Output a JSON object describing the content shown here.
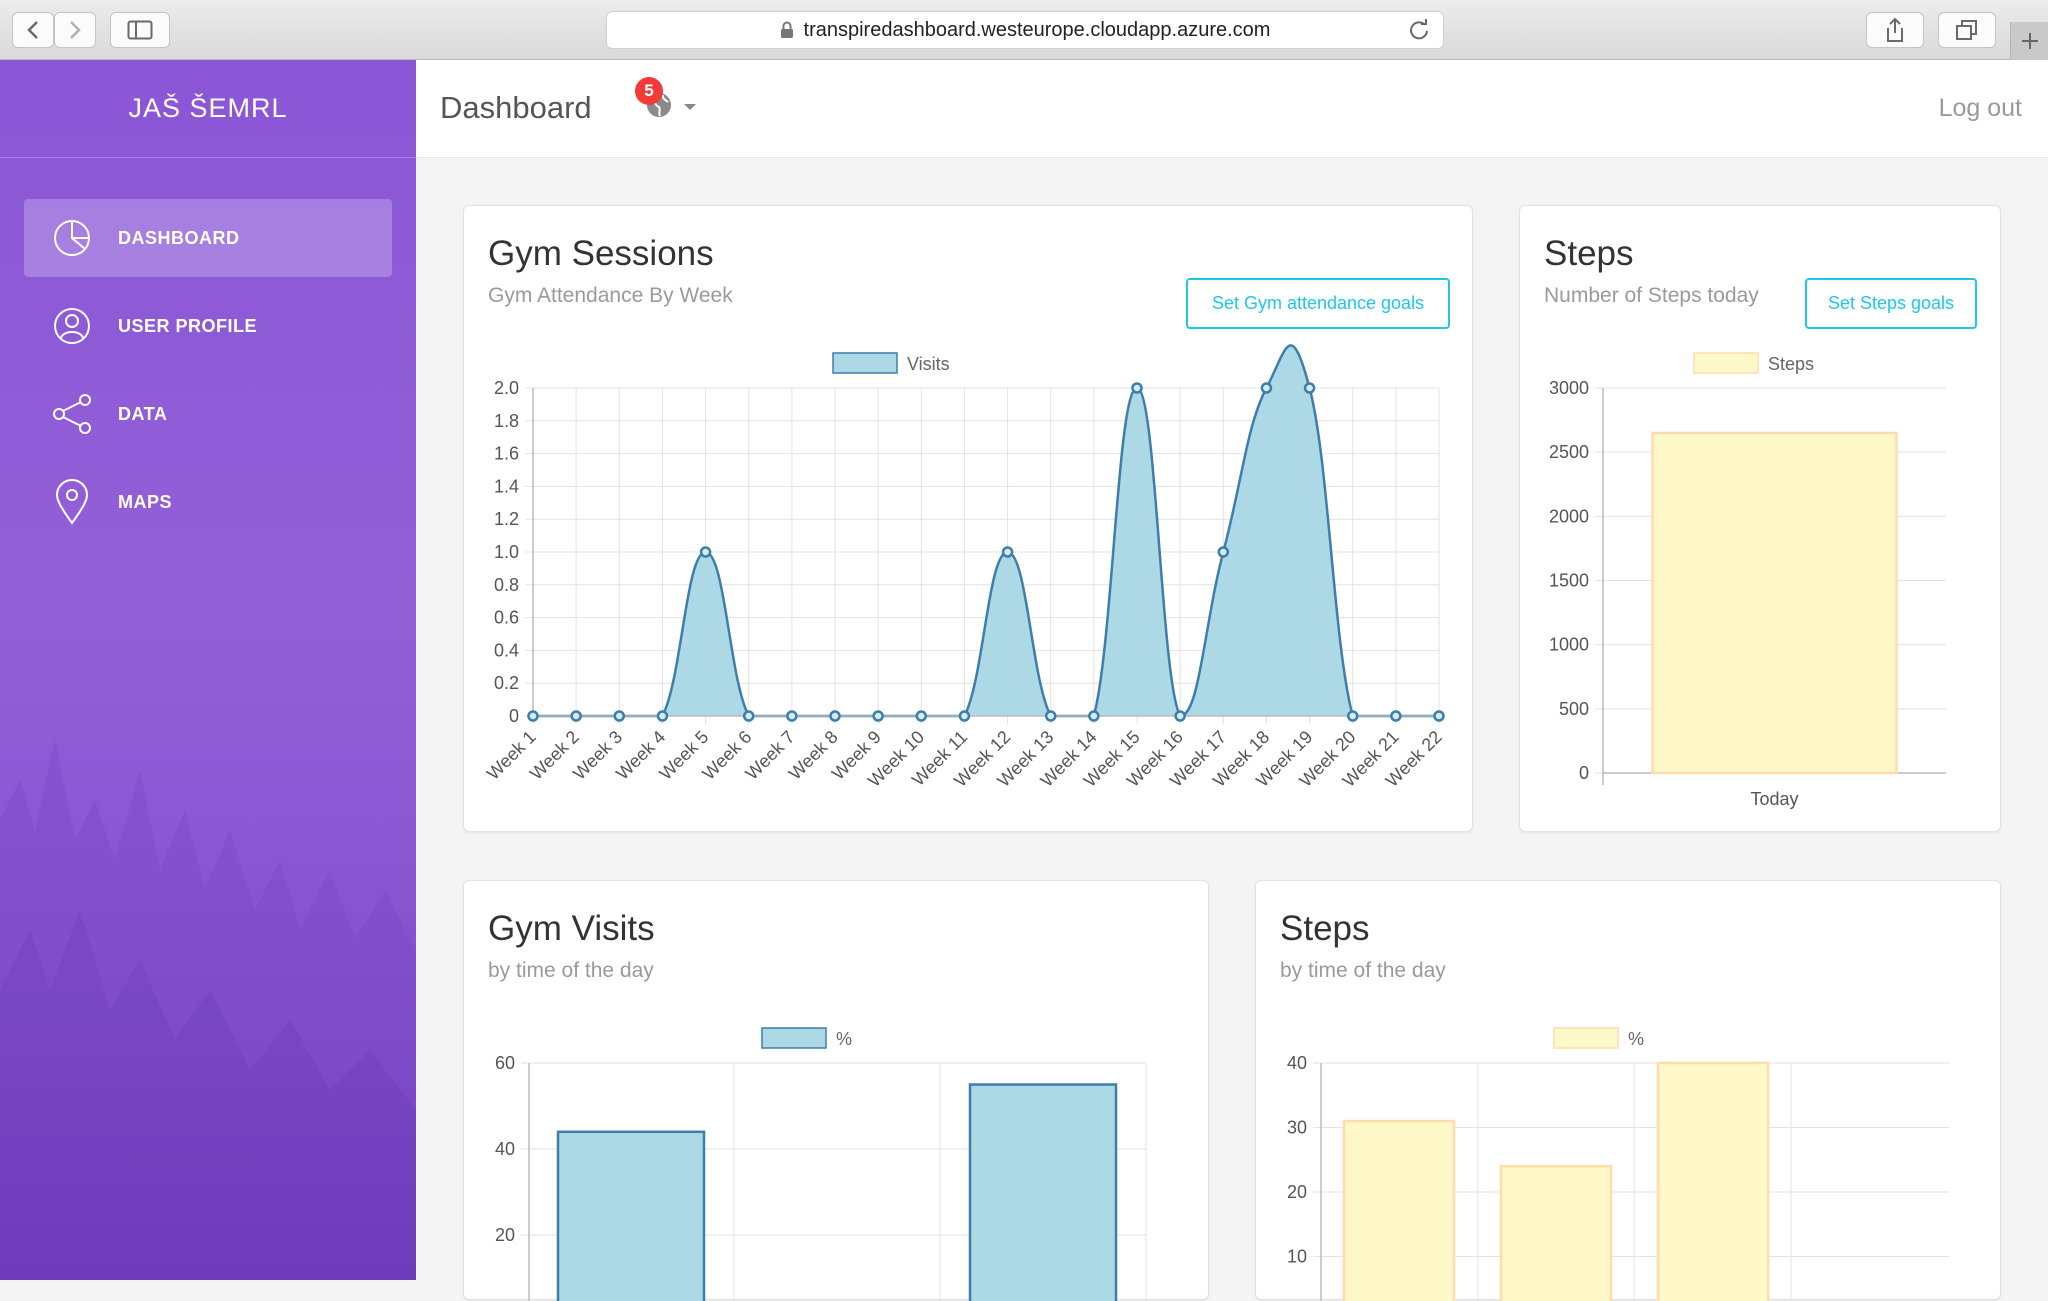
{
  "browser": {
    "url": "transpiredashboard.westeurope.cloudapp.azure.com"
  },
  "sidebar": {
    "brand": "JAŠ ŠEMRL",
    "items": [
      {
        "label": "DASHBOARD",
        "icon": "pie-chart-icon",
        "active": true
      },
      {
        "label": "USER PROFILE",
        "icon": "user-icon",
        "active": false
      },
      {
        "label": "DATA",
        "icon": "share-icon",
        "active": false
      },
      {
        "label": "MAPS",
        "icon": "map-pin-icon",
        "active": false
      }
    ]
  },
  "topbar": {
    "title": "Dashboard",
    "notification_count": "5",
    "logout": "Log out"
  },
  "cards": {
    "gym_sessions": {
      "title": "Gym Sessions",
      "subtitle": "Gym Attendance By Week",
      "button": "Set Gym attendance goals"
    },
    "steps": {
      "title": "Steps",
      "subtitle": "Number of Steps today",
      "button": "Set Steps goals"
    },
    "gym_visits": {
      "title": "Gym Visits",
      "subtitle": "by time of the day"
    },
    "steps_time": {
      "title": "Steps",
      "subtitle": "by time of the day"
    }
  },
  "colors": {
    "accent": "#1dc7ea",
    "sidebar": "#8a56d6",
    "blue_fill": "#add8e6",
    "blue_line": "#3d7eaa",
    "yellow_fill": "#fff8c9",
    "yellow_line": "#ffdcaa"
  },
  "chart_data": [
    {
      "id": "gym-sessions",
      "type": "area",
      "legend": "Visits",
      "categories": [
        "Week 1",
        "Week 2",
        "Week 3",
        "Week 4",
        "Week 5",
        "Week 6",
        "Week 7",
        "Week 8",
        "Week 9",
        "Week 10",
        "Week 11",
        "Week 12",
        "Week 13",
        "Week 14",
        "Week 15",
        "Week 16",
        "Week 17",
        "Week 18",
        "Week 19",
        "Week 20",
        "Week 21",
        "Week 22"
      ],
      "values": [
        0,
        0,
        0,
        0,
        1,
        0,
        0,
        0,
        0,
        0,
        0,
        1,
        0,
        0,
        2,
        0,
        1,
        2,
        2,
        0,
        0,
        0
      ],
      "ylim": [
        0,
        2.0
      ],
      "yticks": [
        "0",
        "0.2",
        "0.4",
        "0.6",
        "0.8",
        "1.0",
        "1.2",
        "1.4",
        "1.6",
        "1.8",
        "2.0"
      ],
      "grid": true
    },
    {
      "id": "steps-today",
      "type": "bar",
      "legend": "Steps",
      "categories": [
        "Today"
      ],
      "values": [
        2650
      ],
      "ylim": [
        0,
        3000
      ],
      "yticks": [
        "0",
        "500",
        "1000",
        "1500",
        "2000",
        "2500",
        "3000"
      ]
    },
    {
      "id": "gym-visits-time",
      "type": "bar",
      "legend": "%",
      "values": [
        44,
        55
      ],
      "yticks_visible": [
        "20",
        "40",
        "60"
      ],
      "ylim": [
        0,
        60
      ]
    },
    {
      "id": "steps-time",
      "type": "bar",
      "legend": "%",
      "values": [
        31,
        24,
        40
      ],
      "yticks_visible": [
        "10",
        "20",
        "30",
        "40"
      ],
      "ylim": [
        0,
        40
      ]
    }
  ]
}
